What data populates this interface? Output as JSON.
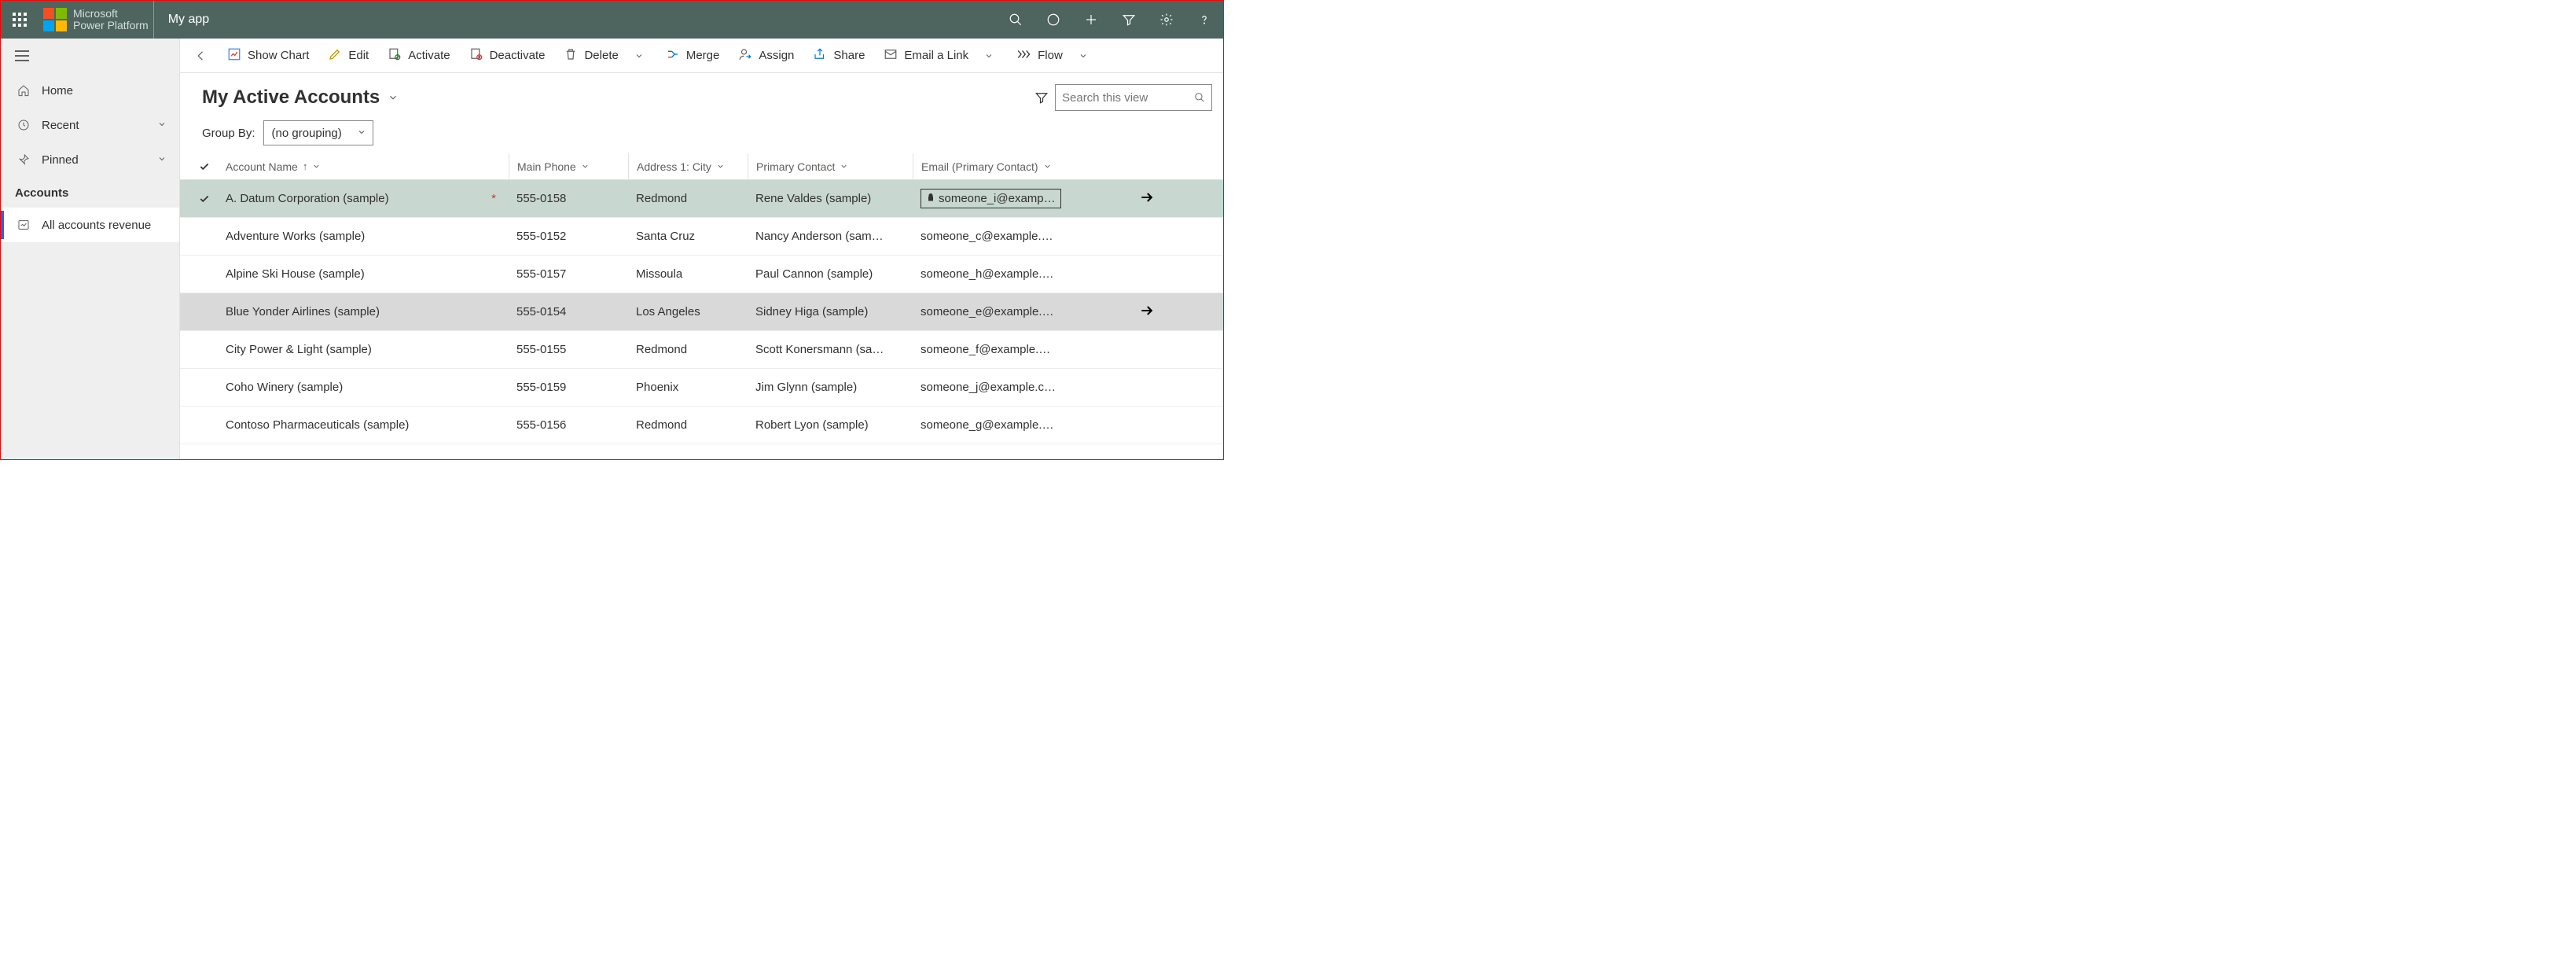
{
  "brand": {
    "l1": "Microsoft",
    "l2": "Power Platform"
  },
  "appname": "My app",
  "sidebar": {
    "home": "Home",
    "recent": "Recent",
    "pinned": "Pinned",
    "group": "Accounts",
    "selected": "All accounts revenue"
  },
  "commands": {
    "showChart": "Show Chart",
    "edit": "Edit",
    "activate": "Activate",
    "deactivate": "Deactivate",
    "delete": "Delete",
    "merge": "Merge",
    "assign": "Assign",
    "share": "Share",
    "emailLink": "Email a Link",
    "flow": "Flow"
  },
  "view": {
    "title": "My Active Accounts",
    "searchPlaceholder": "Search this view",
    "groupByLabel": "Group By:",
    "groupByValue": "(no grouping)"
  },
  "columns": {
    "name": "Account Name",
    "phone": "Main Phone",
    "city": "Address 1: City",
    "contact": "Primary Contact",
    "email": "Email (Primary Contact)"
  },
  "rows": [
    {
      "name": "A. Datum Corporation (sample)",
      "phone": "555-0158",
      "city": "Redmond",
      "contact": "Rene Valdes (sample)",
      "email": "someone_i@examp…",
      "selected": true,
      "starred": true,
      "locked": true,
      "arrow": true
    },
    {
      "name": "Adventure Works (sample)",
      "phone": "555-0152",
      "city": "Santa Cruz",
      "contact": "Nancy Anderson (sam…",
      "email": "someone_c@example.…"
    },
    {
      "name": "Alpine Ski House (sample)",
      "phone": "555-0157",
      "city": "Missoula",
      "contact": "Paul Cannon (sample)",
      "email": "someone_h@example.…"
    },
    {
      "name": "Blue Yonder Airlines (sample)",
      "phone": "555-0154",
      "city": "Los Angeles",
      "contact": "Sidney Higa (sample)",
      "email": "someone_e@example.…",
      "hover": true,
      "arrow": true
    },
    {
      "name": "City Power & Light (sample)",
      "phone": "555-0155",
      "city": "Redmond",
      "contact": "Scott Konersmann (sa…",
      "email": "someone_f@example.…"
    },
    {
      "name": "Coho Winery (sample)",
      "phone": "555-0159",
      "city": "Phoenix",
      "contact": "Jim Glynn (sample)",
      "email": "someone_j@example.c…"
    },
    {
      "name": "Contoso Pharmaceuticals (sample)",
      "phone": "555-0156",
      "city": "Redmond",
      "contact": "Robert Lyon (sample)",
      "email": "someone_g@example.…"
    }
  ]
}
